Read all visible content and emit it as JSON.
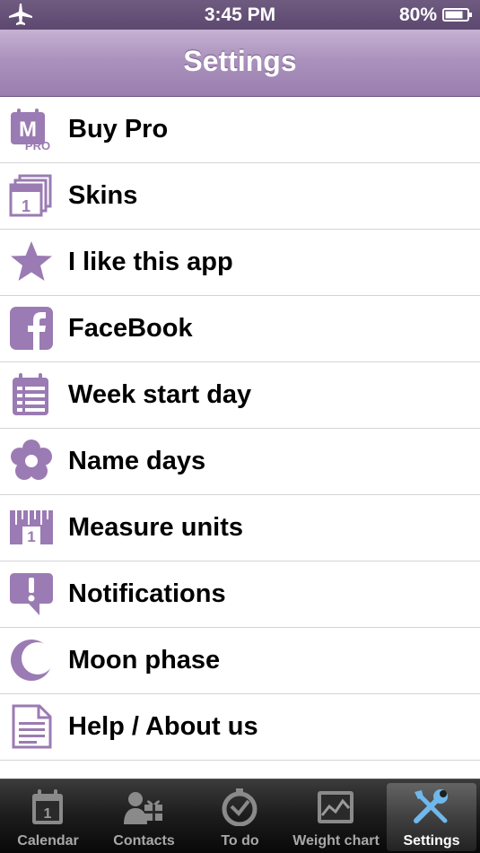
{
  "status_bar": {
    "time": "3:45 PM",
    "battery": "80%"
  },
  "nav": {
    "title": "Settings"
  },
  "settings": [
    {
      "label": "Buy Pro",
      "icon": "pro-calendar-icon"
    },
    {
      "label": "Skins",
      "icon": "skins-icon"
    },
    {
      "label": "I like this app",
      "icon": "star-icon"
    },
    {
      "label": "FaceBook",
      "icon": "facebook-icon"
    },
    {
      "label": "Week start day",
      "icon": "calendar-list-icon"
    },
    {
      "label": "Name days",
      "icon": "flower-icon"
    },
    {
      "label": "Measure units",
      "icon": "ruler-icon"
    },
    {
      "label": "Notifications",
      "icon": "exclamation-bubble-icon"
    },
    {
      "label": "Moon phase",
      "icon": "moon-icon"
    },
    {
      "label": "Help / About us",
      "icon": "document-icon"
    }
  ],
  "icon_pro_text": {
    "m": "M",
    "pro": "PRO",
    "one": "1"
  },
  "tabs": [
    {
      "label": "Calendar",
      "icon": "calendar-icon"
    },
    {
      "label": "Contacts",
      "icon": "contacts-icon"
    },
    {
      "label": "To do",
      "icon": "stopwatch-icon"
    },
    {
      "label": "Weight chart",
      "icon": "chart-icon"
    },
    {
      "label": "Settings",
      "icon": "tools-icon",
      "selected": true
    }
  ],
  "colors": {
    "accent": "#9b7bb3",
    "nav": "#ab92bd",
    "tab_selected": "#ffffff",
    "tab_text": "#a8a8a8"
  }
}
